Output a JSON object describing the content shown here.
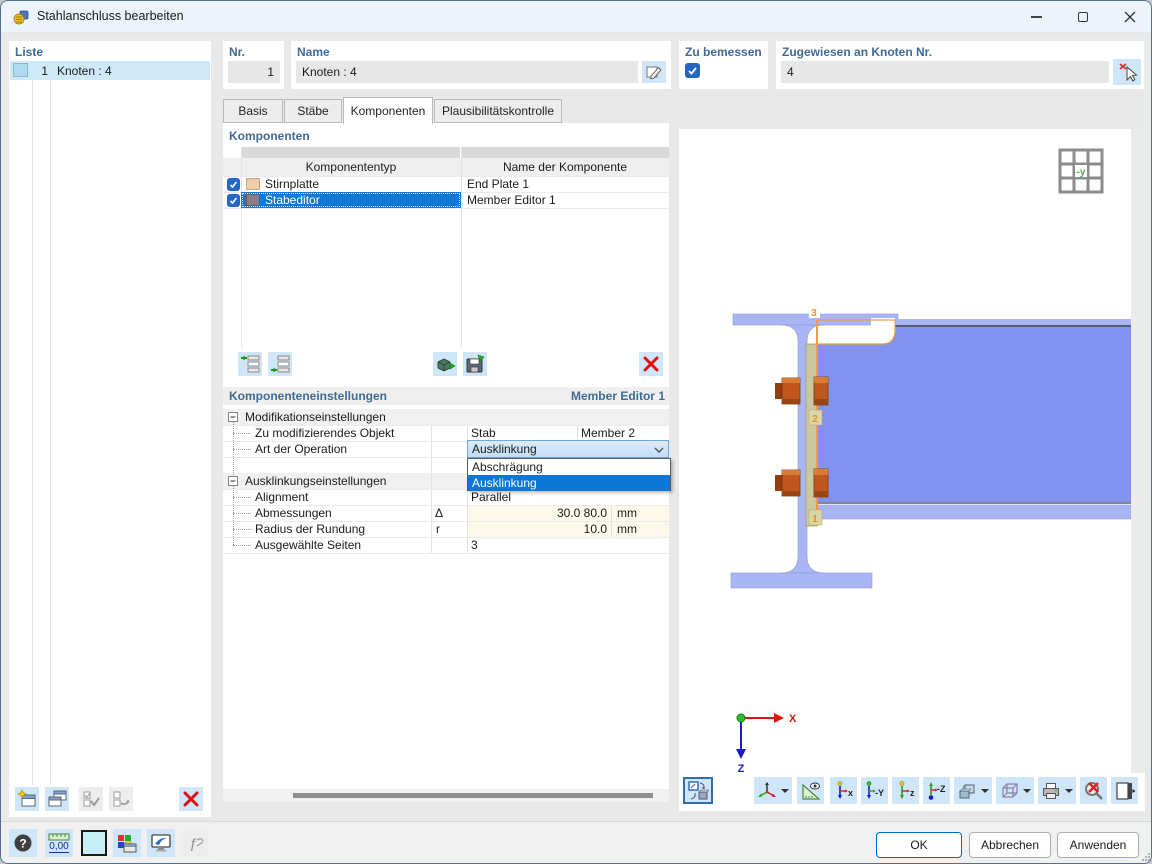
{
  "window": {
    "title": "Stahlanschluss bearbeiten"
  },
  "colors": {
    "accent": "#0078d7",
    "list_selection": "#cfe9f9",
    "row_selection": "#0f79d5",
    "combo_highlight": "#0b76d6",
    "beam": "#8193ee",
    "beam_light": "#a9b6f3",
    "end_plate": "#cbc79e",
    "bolt": "#c1571f",
    "notch_outline": "#ef9d3f",
    "icon_button_bg": "#cfe6f8",
    "header_label": "#3f6a94"
  },
  "sidebar": {
    "title": "Liste",
    "items": [
      {
        "num": "1",
        "label": "Knoten : 4",
        "swatch": "#aedcee",
        "selected": true
      }
    ]
  },
  "header": {
    "nr": {
      "label": "Nr.",
      "value": "1"
    },
    "name": {
      "label": "Name",
      "value": "Knoten : 4"
    },
    "zu_bemessen": {
      "label": "Zu bemessen",
      "checked": true
    },
    "zugewiesen": {
      "label": "Zugewiesen an Knoten Nr.",
      "value": "4"
    }
  },
  "tabs": [
    {
      "label": "Basis",
      "active": false
    },
    {
      "label": "Stäbe",
      "active": false
    },
    {
      "label": "Komponenten",
      "active": true
    },
    {
      "label": "Plausibilitätskontrolle",
      "active": false
    }
  ],
  "components": {
    "title": "Komponenten",
    "columns": {
      "type": "Komponententyp",
      "name": "Name der Komponente"
    },
    "rows": [
      {
        "checked": true,
        "type": "Stirnplatte",
        "name": "End Plate 1",
        "swatch": "#eccfa8",
        "selected": false
      },
      {
        "checked": true,
        "type": "Stabeditor",
        "name": "Member Editor 1",
        "swatch": "#8d7a85",
        "selected": true
      }
    ]
  },
  "settings": {
    "title": "Komponenteneinstellungen",
    "subtitle": "Member Editor 1",
    "group1": {
      "label": "Modifikationseinstellungen"
    },
    "row_object": {
      "label": "Zu modifizierendes Objekt",
      "value1": "Stab",
      "value2": "Member 2"
    },
    "row_operation": {
      "label": "Art der Operation",
      "value": "Ausklinkung"
    },
    "group2": {
      "label": "Ausklinkungseinstellungen"
    },
    "row_alignment": {
      "label": "Alignment",
      "value": "Parallel"
    },
    "row_dimensions": {
      "label": "Abmessungen",
      "symbol": "Δ",
      "value": "30.0 80.0",
      "unit": "mm"
    },
    "row_radius": {
      "label": "Radius der Rundung",
      "symbol": "r",
      "value": "10.0",
      "unit": "mm"
    },
    "row_sides": {
      "label": "Ausgewählte Seiten",
      "value": "3"
    }
  },
  "dropdown": {
    "options": [
      {
        "label": "Abschrägung",
        "selected": false
      },
      {
        "label": "Ausklinkung",
        "selected": true
      }
    ]
  },
  "viewport": {
    "orientation": "-y",
    "axis_x": "X",
    "axis_z": "Z",
    "labels": {
      "side1": "1",
      "side2": "2",
      "side3": "3"
    },
    "axis_buttons": [
      "x",
      "-Y",
      "z",
      "-Z"
    ]
  },
  "footer": {
    "decimals": "0,00",
    "ok": "OK",
    "cancel": "Abbrechen",
    "apply": "Anwenden"
  }
}
